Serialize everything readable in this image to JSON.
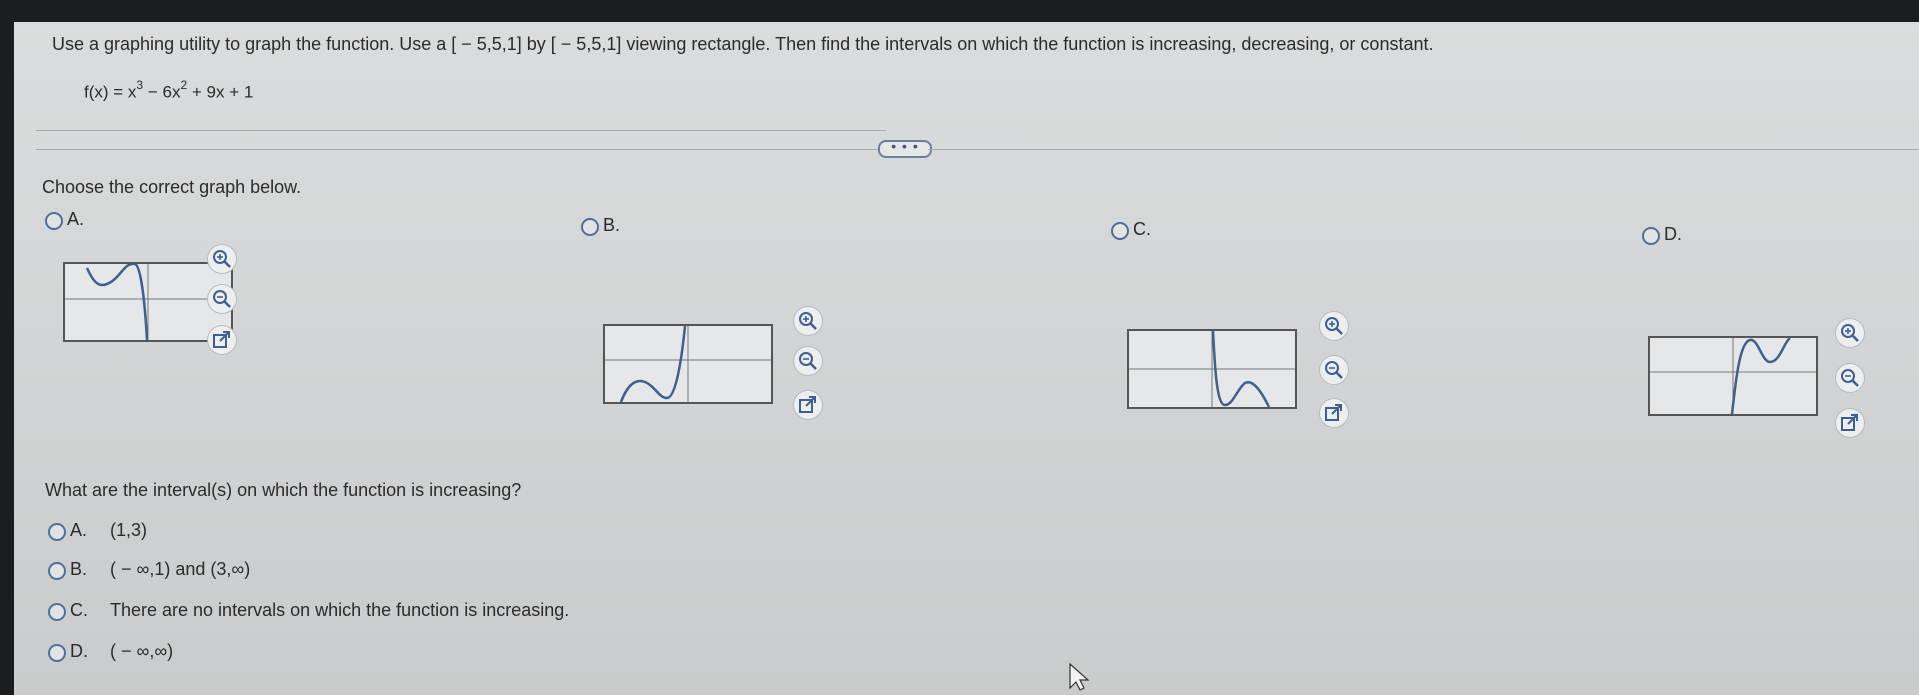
{
  "question": {
    "instruction": "Use a graphing utility to graph the function. Use a [ − 5,5,1] by [ − 5,5,1] viewing rectangle. Then find the intervals on which the function is increasing, decreasing, or constant.",
    "function_text": "f(x) = x³ − 6x² + 9x + 1"
  },
  "more_button": "• • •",
  "part1": {
    "prompt": "Choose the correct graph below.",
    "options": [
      {
        "letter": "A.",
        "shape": "shifted-left",
        "tools": [
          "zoom-in-icon",
          "zoom-out-icon",
          "open-new-window-icon"
        ]
      },
      {
        "letter": "B.",
        "shape": "shifted-down",
        "tools": [
          "zoom-in-icon",
          "zoom-out-icon",
          "open-new-window-icon"
        ]
      },
      {
        "letter": "C.",
        "shape": "reflected",
        "tools": [
          "zoom-in-icon",
          "zoom-out-icon",
          "open-new-window-icon"
        ]
      },
      {
        "letter": "D.",
        "shape": "correct-up",
        "tools": [
          "zoom-in-icon",
          "zoom-out-icon",
          "open-new-window-icon"
        ]
      }
    ]
  },
  "part2": {
    "prompt": "What are the interval(s) on which the function is increasing?",
    "choices": [
      {
        "letter": "A.",
        "text": "(1,3)"
      },
      {
        "letter": "B.",
        "text": "( − ∞,1) and (3,∞)"
      },
      {
        "letter": "C.",
        "text": "There are no intervals on which the function is increasing."
      },
      {
        "letter": "D.",
        "text": "( − ∞,∞)"
      }
    ]
  },
  "colors": {
    "radio_border": "#4f6f9a",
    "graph_curve": "#3f5f8f",
    "background": "#d3d5d6"
  }
}
